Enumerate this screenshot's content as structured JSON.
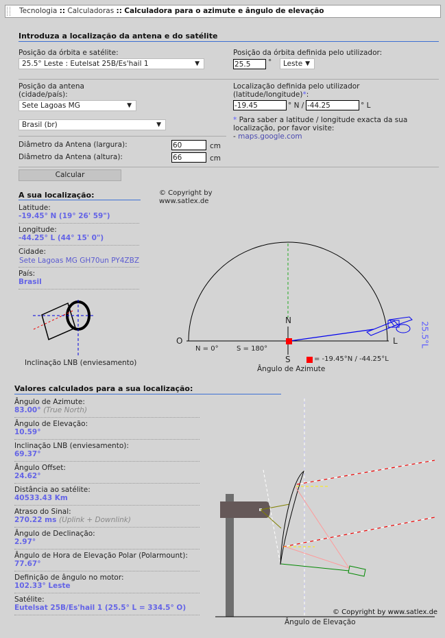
{
  "breadcrumb": {
    "items": [
      "Tecnologia",
      "Calculadoras"
    ],
    "separator": "::",
    "current": "Calculadora para o azimute e ângulo de elevação"
  },
  "form": {
    "title": "Introduza a localização da antena e do satélite",
    "orbit_label": "Posição da órbita e satélite:",
    "orbit_value": "25.5° Leste : Eutelsat 25B/Es'hail 1",
    "user_orbit_label": "Posição da órbita definida pelo utilizador:",
    "user_orbit_value": "25.5",
    "degree": "°",
    "direction_value": "Leste",
    "antenna_label_1": "Posição da antena",
    "antenna_label_2": "(cidade/país):",
    "city_value": "Sete Lagoas  MG",
    "country_value": "Brasil (br)",
    "user_loc_label_1": "Localização definida pelo utilizador",
    "user_loc_label_2": "(latitude/longitude)",
    "asterisk": "*",
    "lat_value": "-19.45",
    "lat_suffix": "° N /",
    "lon_value": "-44.25",
    "lon_suffix": "° L",
    "note_1": "Para saber a latitude / longitude exacta da sua",
    "note_2": "localização, por favor visite:",
    "note_dash": "-",
    "note_link": "maps.google.com",
    "width_label": "Diâmetro da Antena (largura):",
    "width_value": "60",
    "height_label": "Diâmetro da Antena (altura):",
    "height_value": "66",
    "unit": "cm",
    "calc_button": "Calcular"
  },
  "location": {
    "title": "A sua localização:",
    "items": [
      {
        "label": "Latitude:",
        "value": "-19.45° N (19° 26' 59\")"
      },
      {
        "label": "Longitude:",
        "value": "-44.25° L (44° 15' 0\")"
      },
      {
        "label": "Cidade:",
        "value": "Sete Lagoas  MG GH70un   PY4ZBZ"
      },
      {
        "label": "País:",
        "value": "Brasil"
      }
    ],
    "lnb_caption": "Inclinação LNB (enviesamento)"
  },
  "azimuth": {
    "copyright_1": "© Copyright by",
    "copyright_2": "www.satlex.de",
    "west": "O",
    "east": "L",
    "north": "N",
    "south": "S",
    "n_label": "N = 0°",
    "s_label": "S = 180°",
    "sat_label": "25.5°L",
    "legend": "= -19.45°N / -44.25°L",
    "caption": "Ângulo de Azimute",
    "azimuth_deg": 83.0
  },
  "results": {
    "title": "Valores calculados para a sua localização:",
    "items": [
      {
        "label": "Ângulo de Azimute:",
        "value": "83.00°",
        "note": "(True North)"
      },
      {
        "label": "Ângulo de Elevação:",
        "value": "10.59°",
        "note": ""
      },
      {
        "label": "Inclinação LNB (enviesamento):",
        "value": "69.37°",
        "note": ""
      },
      {
        "label": "Ângulo Offset:",
        "value": "24.62°",
        "note": ""
      },
      {
        "label": "Distância ao satélite:",
        "value": "40533.43 Km",
        "note": ""
      },
      {
        "label": "Atraso do Sinal:",
        "value": "270.22 ms",
        "note": "(Uplink + Downlink)"
      },
      {
        "label": "Ângulo de Declinação:",
        "value": "2.97°",
        "note": ""
      },
      {
        "label": "Ângulo de Hora de Elevação Polar (Polarmount):",
        "value": "77.67°",
        "note": ""
      },
      {
        "label": "Definição de ângulo no motor:",
        "value": "102.33° Leste",
        "note": ""
      },
      {
        "label": "Satélite:",
        "value": "Eutelsat 25B/Es'hail 1 (25.5° L = 334.5° O)",
        "note": ""
      }
    ]
  },
  "elevation": {
    "copyright": "© Copyright by www.satlex.de",
    "caption": "Ângulo de Elevação"
  }
}
